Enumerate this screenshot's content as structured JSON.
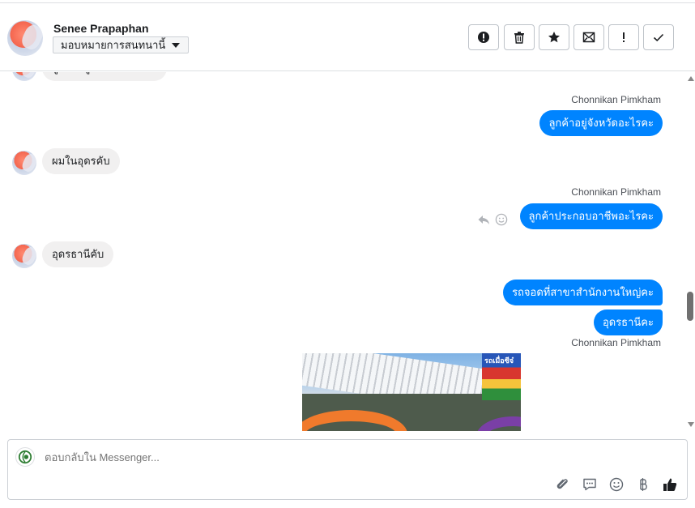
{
  "header": {
    "contact_name": "Senee Prapaphan",
    "assign_label": "มอบหมายการสนทนานี้",
    "toolbar": [
      "alert-circle-icon",
      "trash-icon",
      "star-icon",
      "mail-icon",
      "exclamation-icon",
      "check-icon"
    ]
  },
  "conversation": {
    "partial_top_text": "ลูกค้าอยู่จังหวัดอะไรคะ",
    "messages": [
      {
        "dir": "out",
        "sender": "Chonnikan Pimkham",
        "text": "ลูกค้าอยู่จังหวัดอะไรคะ"
      },
      {
        "dir": "in",
        "text": "ผมในอุดรคับ"
      },
      {
        "dir": "out",
        "sender": "Chonnikan Pimkham",
        "text": "ลูกค้าประกอบอาชีพอะไรคะ"
      },
      {
        "dir": "in",
        "text": "อุดรธานีคับ"
      },
      {
        "dir": "out",
        "text": "รถจอดที่สาขาสำนักงานใหญ่คะ"
      },
      {
        "dir": "out",
        "text": "อุดรธานีคะ"
      },
      {
        "dir": "out",
        "sender": "Chonnikan Pimkham",
        "type": "image",
        "sign_text": "รถเมื่อซีจ๋"
      }
    ]
  },
  "composer": {
    "placeholder": "ตอบกลับใน Messenger...",
    "tools": [
      "paperclip-icon",
      "saved-reply-icon",
      "emoji-icon",
      "baht-icon",
      "like-icon"
    ]
  },
  "colors": {
    "accent": "#0084ff",
    "incoming_bubble": "#f1f0f0",
    "border": "#ccd0d5"
  }
}
